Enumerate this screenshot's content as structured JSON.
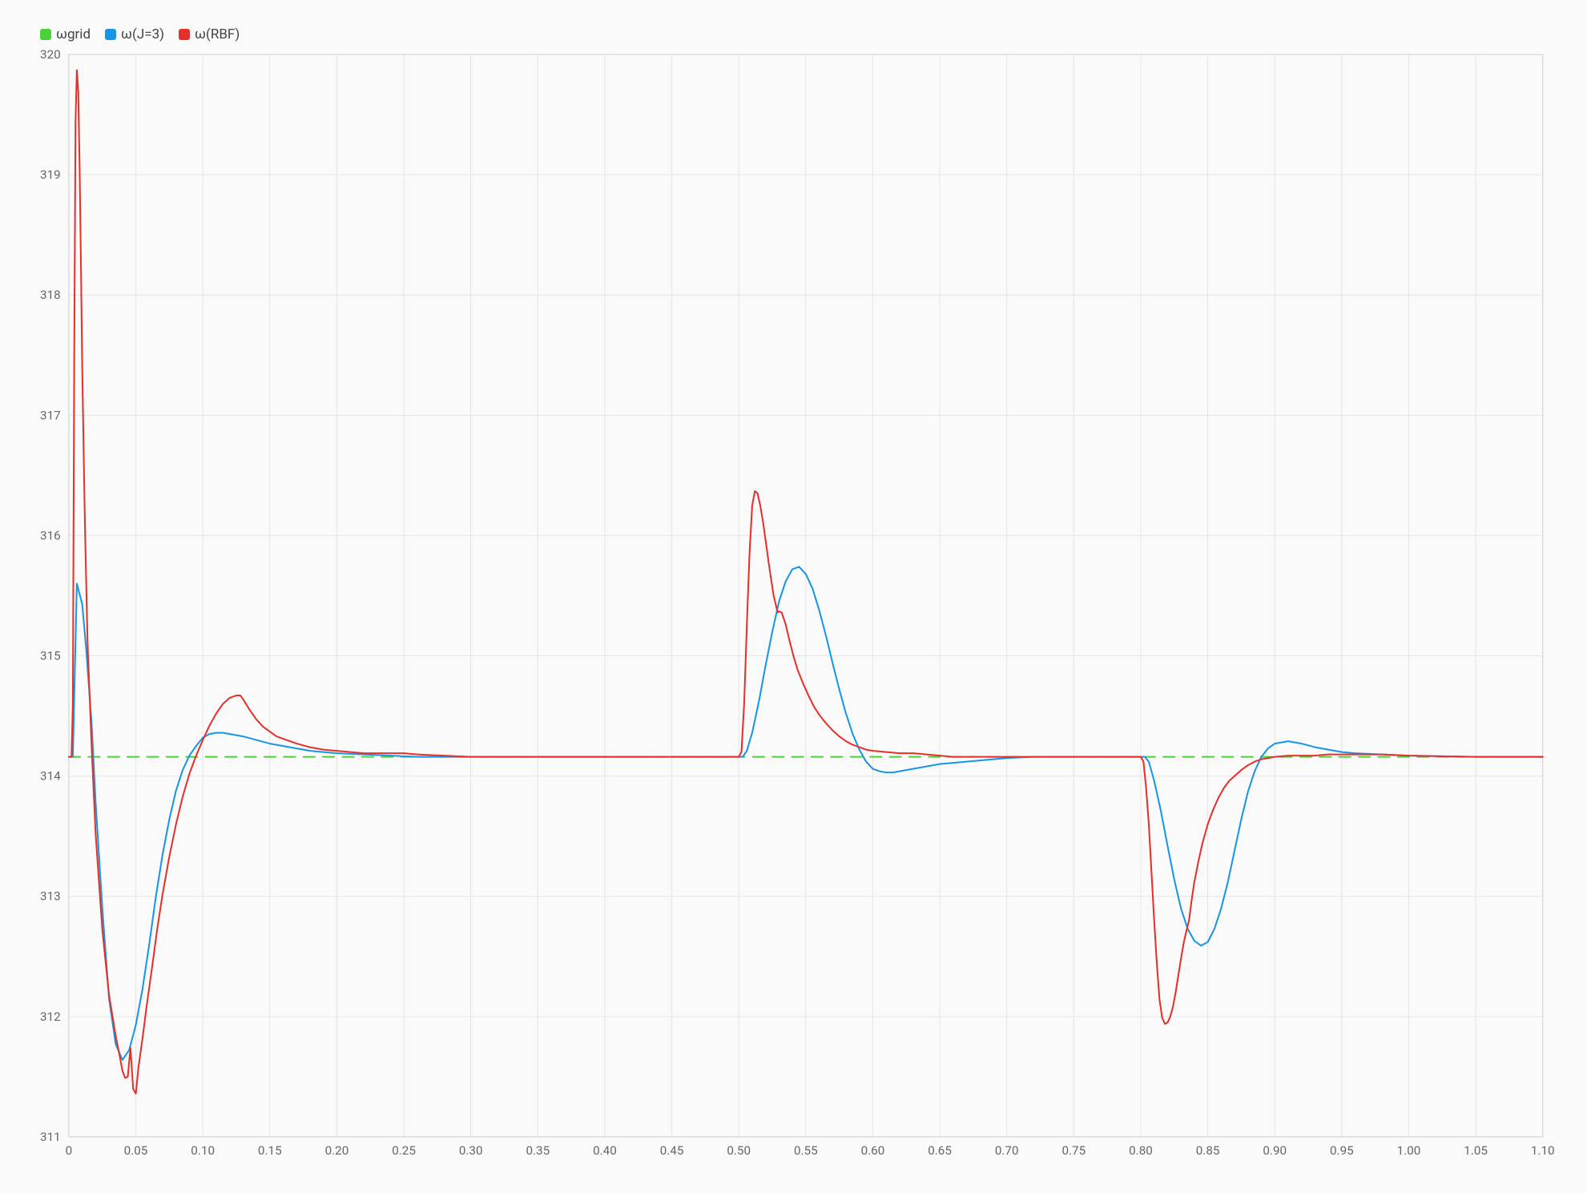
{
  "chart_data": {
    "type": "line",
    "xlim": [
      0,
      1.1
    ],
    "ylim": [
      311,
      320
    ],
    "xticks": [
      0,
      0.05,
      0.1,
      0.15,
      0.2,
      0.25,
      0.3,
      0.35,
      0.4,
      0.45,
      0.5,
      0.55,
      0.6,
      0.65,
      0.7,
      0.75,
      0.8,
      0.85,
      0.9,
      0.95,
      1.0,
      1.05,
      1.1
    ],
    "yticks": [
      311,
      312,
      313,
      314,
      315,
      316,
      317,
      318,
      319,
      320
    ],
    "legend": [
      {
        "name": "ωgrid",
        "color": "#4bd13b",
        "dash": true
      },
      {
        "name": "ω(J=3)",
        "color": "#1796e6",
        "dash": false
      },
      {
        "name": "ω(RBF)",
        "color": "#e7302a",
        "dash": false
      }
    ],
    "series": [
      {
        "name": "ωgrid",
        "color": "#4bd13b",
        "dash": true,
        "points": [
          [
            0.0,
            314.16
          ],
          [
            1.1,
            314.16
          ]
        ]
      },
      {
        "name": "ω(J=3)",
        "color": "#1796e6",
        "dash": false,
        "points": [
          [
            0.0,
            314.16
          ],
          [
            0.003,
            314.16
          ],
          [
            0.006,
            315.6
          ],
          [
            0.01,
            315.43
          ],
          [
            0.013,
            315.05
          ],
          [
            0.017,
            314.44
          ],
          [
            0.02,
            313.78
          ],
          [
            0.025,
            312.9
          ],
          [
            0.03,
            312.15
          ],
          [
            0.035,
            311.77
          ],
          [
            0.04,
            311.64
          ],
          [
            0.045,
            311.72
          ],
          [
            0.05,
            311.93
          ],
          [
            0.055,
            312.23
          ],
          [
            0.06,
            312.6
          ],
          [
            0.065,
            313.0
          ],
          [
            0.07,
            313.35
          ],
          [
            0.075,
            313.64
          ],
          [
            0.08,
            313.88
          ],
          [
            0.085,
            314.05
          ],
          [
            0.09,
            314.17
          ],
          [
            0.095,
            314.25
          ],
          [
            0.1,
            314.32
          ],
          [
            0.105,
            314.35
          ],
          [
            0.11,
            314.36
          ],
          [
            0.115,
            314.36
          ],
          [
            0.12,
            314.35
          ],
          [
            0.13,
            314.33
          ],
          [
            0.14,
            314.3
          ],
          [
            0.15,
            314.27
          ],
          [
            0.16,
            314.25
          ],
          [
            0.17,
            314.23
          ],
          [
            0.18,
            314.21
          ],
          [
            0.19,
            314.2
          ],
          [
            0.2,
            314.19
          ],
          [
            0.22,
            314.18
          ],
          [
            0.24,
            314.17
          ],
          [
            0.26,
            314.16
          ],
          [
            0.3,
            314.16
          ],
          [
            0.5,
            314.16
          ],
          [
            0.503,
            314.16
          ],
          [
            0.506,
            314.21
          ],
          [
            0.51,
            314.36
          ],
          [
            0.515,
            314.62
          ],
          [
            0.52,
            314.92
          ],
          [
            0.525,
            315.2
          ],
          [
            0.53,
            315.45
          ],
          [
            0.535,
            315.62
          ],
          [
            0.54,
            315.72
          ],
          [
            0.545,
            315.74
          ],
          [
            0.55,
            315.68
          ],
          [
            0.555,
            315.56
          ],
          [
            0.56,
            315.38
          ],
          [
            0.565,
            315.17
          ],
          [
            0.57,
            314.94
          ],
          [
            0.575,
            314.72
          ],
          [
            0.58,
            314.52
          ],
          [
            0.585,
            314.35
          ],
          [
            0.59,
            314.22
          ],
          [
            0.595,
            314.12
          ],
          [
            0.6,
            314.06
          ],
          [
            0.605,
            314.04
          ],
          [
            0.61,
            314.03
          ],
          [
            0.615,
            314.03
          ],
          [
            0.62,
            314.04
          ],
          [
            0.625,
            314.05
          ],
          [
            0.63,
            314.06
          ],
          [
            0.64,
            314.08
          ],
          [
            0.65,
            314.1
          ],
          [
            0.66,
            314.11
          ],
          [
            0.68,
            314.13
          ],
          [
            0.7,
            314.15
          ],
          [
            0.72,
            314.16
          ],
          [
            0.8,
            314.16
          ],
          [
            0.803,
            314.16
          ],
          [
            0.806,
            314.12
          ],
          [
            0.81,
            313.96
          ],
          [
            0.815,
            313.71
          ],
          [
            0.82,
            313.42
          ],
          [
            0.825,
            313.14
          ],
          [
            0.83,
            312.9
          ],
          [
            0.835,
            312.73
          ],
          [
            0.84,
            312.63
          ],
          [
            0.845,
            312.59
          ],
          [
            0.85,
            312.62
          ],
          [
            0.855,
            312.73
          ],
          [
            0.86,
            312.9
          ],
          [
            0.865,
            313.12
          ],
          [
            0.87,
            313.38
          ],
          [
            0.875,
            313.64
          ],
          [
            0.88,
            313.87
          ],
          [
            0.885,
            314.04
          ],
          [
            0.89,
            314.16
          ],
          [
            0.895,
            314.23
          ],
          [
            0.9,
            314.27
          ],
          [
            0.905,
            314.28
          ],
          [
            0.91,
            314.29
          ],
          [
            0.915,
            314.28
          ],
          [
            0.92,
            314.27
          ],
          [
            0.93,
            314.24
          ],
          [
            0.94,
            314.22
          ],
          [
            0.95,
            314.2
          ],
          [
            0.96,
            314.19
          ],
          [
            0.98,
            314.18
          ],
          [
            1.0,
            314.17
          ],
          [
            1.05,
            314.16
          ],
          [
            1.1,
            314.16
          ]
        ]
      },
      {
        "name": "ω(RBF)",
        "color": "#e7302a",
        "dash": false,
        "points": [
          [
            0.0,
            314.16
          ],
          [
            0.002,
            314.16
          ],
          [
            0.003,
            314.6
          ],
          [
            0.004,
            317.4
          ],
          [
            0.005,
            319.44
          ],
          [
            0.006,
            319.87
          ],
          [
            0.007,
            319.7
          ],
          [
            0.008,
            319.1
          ],
          [
            0.009,
            318.3
          ],
          [
            0.01,
            317.4
          ],
          [
            0.012,
            316.1
          ],
          [
            0.014,
            315.1
          ],
          [
            0.017,
            314.25
          ],
          [
            0.02,
            313.52
          ],
          [
            0.025,
            312.72
          ],
          [
            0.03,
            312.18
          ],
          [
            0.035,
            311.84
          ],
          [
            0.038,
            311.67
          ],
          [
            0.04,
            311.55
          ],
          [
            0.042,
            311.49
          ],
          [
            0.044,
            311.5
          ],
          [
            0.046,
            311.74
          ],
          [
            0.048,
            311.4
          ],
          [
            0.05,
            311.36
          ],
          [
            0.052,
            311.58
          ],
          [
            0.055,
            311.82
          ],
          [
            0.058,
            312.08
          ],
          [
            0.062,
            312.4
          ],
          [
            0.066,
            312.73
          ],
          [
            0.07,
            313.02
          ],
          [
            0.075,
            313.33
          ],
          [
            0.08,
            313.6
          ],
          [
            0.085,
            313.83
          ],
          [
            0.09,
            314.02
          ],
          [
            0.095,
            314.17
          ],
          [
            0.1,
            314.3
          ],
          [
            0.105,
            314.42
          ],
          [
            0.11,
            314.52
          ],
          [
            0.115,
            314.6
          ],
          [
            0.12,
            314.65
          ],
          [
            0.125,
            314.67
          ],
          [
            0.128,
            314.67
          ],
          [
            0.13,
            314.64
          ],
          [
            0.135,
            314.55
          ],
          [
            0.14,
            314.47
          ],
          [
            0.145,
            314.41
          ],
          [
            0.15,
            314.37
          ],
          [
            0.155,
            314.33
          ],
          [
            0.16,
            314.31
          ],
          [
            0.17,
            314.27
          ],
          [
            0.18,
            314.24
          ],
          [
            0.19,
            314.22
          ],
          [
            0.2,
            314.21
          ],
          [
            0.21,
            314.2
          ],
          [
            0.22,
            314.19
          ],
          [
            0.23,
            314.19
          ],
          [
            0.24,
            314.19
          ],
          [
            0.25,
            314.19
          ],
          [
            0.26,
            314.18
          ],
          [
            0.28,
            314.17
          ],
          [
            0.3,
            314.16
          ],
          [
            0.5,
            314.16
          ],
          [
            0.502,
            314.2
          ],
          [
            0.504,
            314.6
          ],
          [
            0.506,
            315.25
          ],
          [
            0.508,
            315.85
          ],
          [
            0.51,
            316.25
          ],
          [
            0.512,
            316.37
          ],
          [
            0.514,
            316.35
          ],
          [
            0.516,
            316.25
          ],
          [
            0.518,
            316.12
          ],
          [
            0.52,
            315.96
          ],
          [
            0.523,
            315.72
          ],
          [
            0.526,
            315.5
          ],
          [
            0.529,
            315.36
          ],
          [
            0.53,
            315.37
          ],
          [
            0.532,
            315.36
          ],
          [
            0.535,
            315.26
          ],
          [
            0.538,
            315.12
          ],
          [
            0.541,
            314.99
          ],
          [
            0.544,
            314.88
          ],
          [
            0.548,
            314.77
          ],
          [
            0.552,
            314.67
          ],
          [
            0.556,
            314.58
          ],
          [
            0.56,
            314.51
          ],
          [
            0.565,
            314.44
          ],
          [
            0.57,
            314.38
          ],
          [
            0.575,
            314.33
          ],
          [
            0.58,
            314.29
          ],
          [
            0.585,
            314.26
          ],
          [
            0.59,
            314.24
          ],
          [
            0.595,
            314.22
          ],
          [
            0.6,
            314.21
          ],
          [
            0.61,
            314.2
          ],
          [
            0.62,
            314.19
          ],
          [
            0.63,
            314.19
          ],
          [
            0.64,
            314.18
          ],
          [
            0.65,
            314.17
          ],
          [
            0.66,
            314.16
          ],
          [
            0.68,
            314.16
          ],
          [
            0.7,
            314.16
          ],
          [
            0.8,
            314.16
          ],
          [
            0.802,
            314.12
          ],
          [
            0.804,
            313.9
          ],
          [
            0.806,
            313.6
          ],
          [
            0.808,
            313.2
          ],
          [
            0.81,
            312.8
          ],
          [
            0.812,
            312.44
          ],
          [
            0.814,
            312.14
          ],
          [
            0.816,
            311.99
          ],
          [
            0.818,
            311.94
          ],
          [
            0.82,
            311.95
          ],
          [
            0.822,
            312.0
          ],
          [
            0.824,
            312.08
          ],
          [
            0.826,
            312.2
          ],
          [
            0.828,
            312.34
          ],
          [
            0.83,
            312.48
          ],
          [
            0.832,
            312.61
          ],
          [
            0.834,
            312.71
          ],
          [
            0.836,
            312.8
          ],
          [
            0.838,
            312.97
          ],
          [
            0.84,
            313.12
          ],
          [
            0.843,
            313.29
          ],
          [
            0.846,
            313.44
          ],
          [
            0.85,
            313.6
          ],
          [
            0.854,
            313.72
          ],
          [
            0.858,
            313.82
          ],
          [
            0.862,
            313.9
          ],
          [
            0.866,
            313.96
          ],
          [
            0.87,
            314.0
          ],
          [
            0.875,
            314.05
          ],
          [
            0.88,
            314.09
          ],
          [
            0.885,
            314.12
          ],
          [
            0.89,
            314.14
          ],
          [
            0.895,
            314.15
          ],
          [
            0.9,
            314.16
          ],
          [
            0.91,
            314.17
          ],
          [
            0.92,
            314.17
          ],
          [
            0.93,
            314.17
          ],
          [
            0.94,
            314.18
          ],
          [
            0.95,
            314.18
          ],
          [
            0.96,
            314.18
          ],
          [
            0.98,
            314.18
          ],
          [
            1.0,
            314.17
          ],
          [
            1.05,
            314.16
          ],
          [
            1.1,
            314.16
          ]
        ]
      }
    ]
  }
}
